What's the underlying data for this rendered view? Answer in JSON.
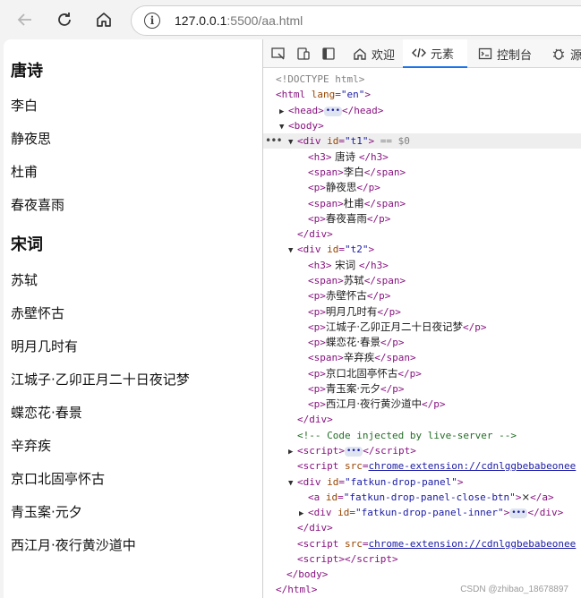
{
  "browser": {
    "url_host": "127.0.0.1",
    "url_rest": ":5500/aa.html"
  },
  "page": {
    "t1": {
      "heading": "唐诗",
      "items": [
        "李白",
        "静夜思",
        "杜甫",
        "春夜喜雨"
      ]
    },
    "t2": {
      "heading": "宋词",
      "items": [
        "苏轼",
        "赤壁怀古",
        "明月几时有",
        "江城子·乙卯正月二十日夜记梦",
        "蝶恋花·春景",
        "辛弃疾",
        "京口北固亭怀古",
        "青玉案·元夕",
        "西江月·夜行黄沙道中"
      ]
    }
  },
  "devtools": {
    "tabs": {
      "welcome": "欢迎",
      "elements": "元素",
      "console": "控制台",
      "sources": "源"
    },
    "doctype": "<!DOCTYPE html>",
    "selected_marker": "== $0",
    "comment": "<!-- Code injected by live-server -->",
    "extension_src": "chrome-extension://cdnlggbebabeonee",
    "ids": {
      "t1": "\"t1\"",
      "t2": "\"t2\"",
      "lang": "\"en\"",
      "panel": "\"fatkun-drop-panel\"",
      "close": "\"fatkun-drop-panel-close-btn\"",
      "inner": "\"fatkun-drop-panel-inner\""
    },
    "close_text": "×",
    "t1_texts": [
      " 唐诗 ",
      "李白",
      "静夜思",
      "杜甫",
      "春夜喜雨"
    ],
    "t2_texts": [
      " 宋词 ",
      "苏轼",
      "赤壁怀古",
      "明月几时有",
      "江城子·乙卯正月二十日夜记梦",
      "蝶恋花·春景",
      "辛弃疾",
      "京口北固亭怀古",
      "青玉案·元夕",
      "西江月·夜行黄沙道中"
    ]
  },
  "watermark": "CSDN @zhibao_18678897"
}
